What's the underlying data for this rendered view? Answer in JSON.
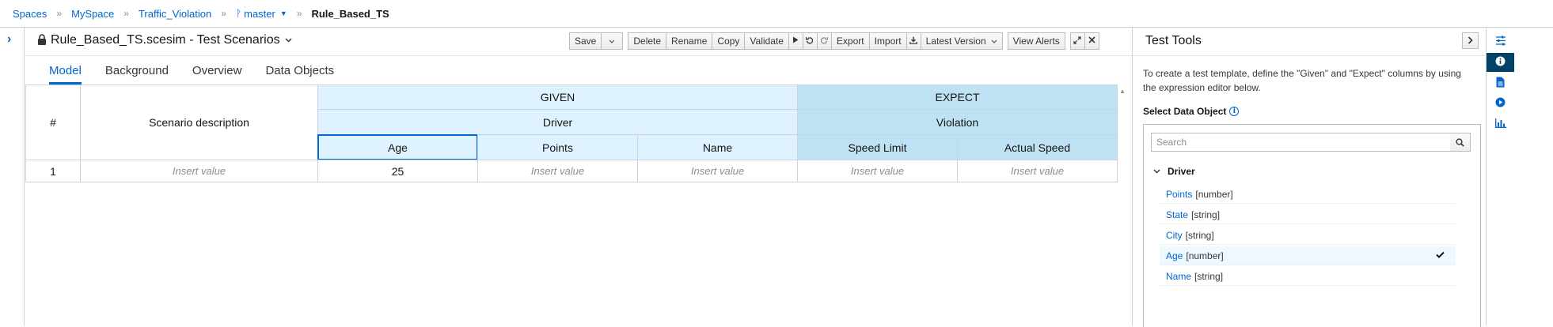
{
  "breadcrumb": {
    "items": [
      "Spaces",
      "MySpace",
      "Traffic_Violation"
    ],
    "branch": "master",
    "current": "Rule_Based_TS"
  },
  "editor": {
    "title": "Rule_Based_TS.scesim - Test Scenarios",
    "toolbar": {
      "save": "Save",
      "delete": "Delete",
      "rename": "Rename",
      "copy": "Copy",
      "validate": "Validate",
      "export": "Export",
      "import": "Import",
      "latest_version": "Latest Version",
      "view_alerts": "View Alerts"
    },
    "tabs": [
      "Model",
      "Background",
      "Overview",
      "Data Objects"
    ],
    "active_tab": "Model"
  },
  "grid": {
    "index_header": "#",
    "description_header": "Scenario description",
    "given_label": "GIVEN",
    "expect_label": "EXPECT",
    "given_instance": "Driver",
    "expect_instance": "Violation",
    "columns": [
      "Age",
      "Points",
      "Name",
      "Speed Limit",
      "Actual Speed"
    ],
    "rows": [
      {
        "index": "1",
        "description": "Insert value",
        "cells": [
          "25",
          "Insert value",
          "Insert value",
          "Insert value",
          "Insert value"
        ]
      }
    ]
  },
  "test_tools": {
    "title": "Test Tools",
    "description": "To create a test template, define the \"Given\" and \"Expect\" columns by using the expression editor below.",
    "select_label": "Select Data Object",
    "search_placeholder": "Search",
    "tree_root": "Driver",
    "fields": [
      {
        "name": "Points",
        "type": "[number]"
      },
      {
        "name": "State",
        "type": "[string]"
      },
      {
        "name": "City",
        "type": "[string]"
      },
      {
        "name": "Age",
        "type": "[number]",
        "selected": true
      },
      {
        "name": "Name",
        "type": "[string]"
      }
    ]
  },
  "colors": {
    "link": "#0066cc",
    "given_bg": "#def3ff",
    "expect_bg": "#bee1f4",
    "rail_active": "#004368"
  },
  "icons": [
    "lock-icon",
    "chevron-down-icon",
    "chevron-right-icon",
    "play-icon",
    "undo-icon",
    "redo-icon",
    "download-icon",
    "expand-icon",
    "close-icon",
    "search-icon",
    "info-icon",
    "check-icon",
    "settings-sliders-icon",
    "document-icon",
    "run-icon",
    "chart-icon"
  ]
}
